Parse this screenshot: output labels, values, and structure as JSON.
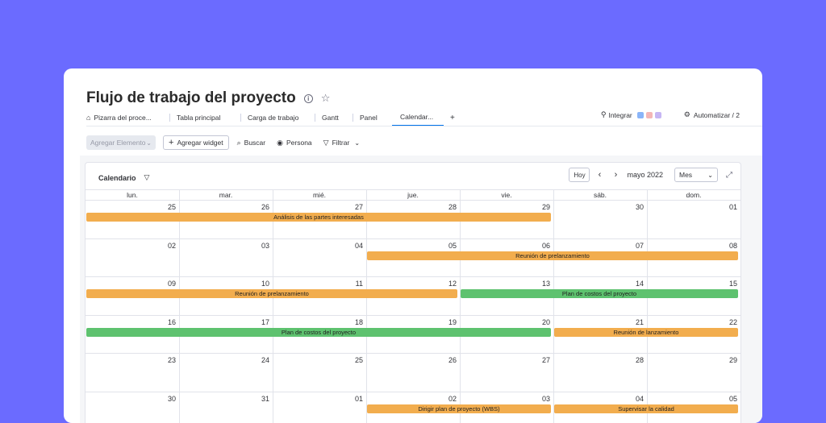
{
  "board": {
    "title": "Flujo de trabajo del proyecto",
    "info_icon": "info-icon",
    "star_icon": "star-icon"
  },
  "tabs": [
    {
      "label": "Pizarra del proce..."
    },
    {
      "label": "Tabla principal"
    },
    {
      "label": "Carga de trabajo"
    },
    {
      "label": "Gantt"
    },
    {
      "label": "Panel"
    },
    {
      "label": "Calendar..."
    },
    {
      "label": "+"
    }
  ],
  "tabs_right": {
    "integrar_label": "Integrar",
    "automatizar_label": "Automatizar / 2"
  },
  "toolbar": {
    "add_item_label": "Agregar Elemento",
    "add_widget_label": "Agregar widget",
    "search_label": "Buscar",
    "person_label": "Persona",
    "filter_label": "Filtrar"
  },
  "calendar": {
    "title": "Calendario",
    "today_label": "Hoy",
    "prev": "‹",
    "next": "›",
    "month_label": "mayo 2022",
    "view_label": "Mes",
    "weekdays": [
      "lun.",
      "mar.",
      "mié.",
      "jue.",
      "vie.",
      "sáb.",
      "dom."
    ],
    "weeks": [
      [
        "25",
        "26",
        "27",
        "28",
        "29",
        "30",
        "01"
      ],
      [
        "02",
        "03",
        "04",
        "05",
        "06",
        "07",
        "08"
      ],
      [
        "09",
        "10",
        "11",
        "12",
        "13",
        "14",
        "15"
      ],
      [
        "16",
        "17",
        "18",
        "19",
        "20",
        "21",
        "22"
      ],
      [
        "23",
        "24",
        "25",
        "26",
        "27",
        "28",
        "29"
      ],
      [
        "30",
        "31",
        "01",
        "02",
        "03",
        "04",
        "05"
      ]
    ],
    "events": [
      {
        "label": "Análisis de las partes interesadas",
        "week": 0,
        "start": 0,
        "end": 4,
        "color": "#f2ad4e"
      },
      {
        "label": "Reunión de prelanzamiento",
        "week": 1,
        "start": 3,
        "end": 6,
        "color": "#f2ad4e"
      },
      {
        "label": "Reunión de prelanzamiento",
        "week": 2,
        "start": 0,
        "end": 3,
        "color": "#f2ad4e"
      },
      {
        "label": "Plan de costos del proyecto",
        "week": 2,
        "start": 4,
        "end": 6,
        "color": "#5ec26f"
      },
      {
        "label": "Plan de costos del proyecto",
        "week": 3,
        "start": 0,
        "end": 4,
        "color": "#5ec26f"
      },
      {
        "label": "Reunión de lanzamiento",
        "week": 3,
        "start": 5,
        "end": 6,
        "color": "#f2ad4e"
      },
      {
        "label": "Dirigir plan de proyecto (WBS)",
        "week": 5,
        "start": 3,
        "end": 4,
        "color": "#f2ad4e"
      },
      {
        "label": "Supervisar la calidad",
        "week": 5,
        "start": 5,
        "end": 6,
        "color": "#f2ad4e"
      }
    ]
  },
  "colors": {
    "background": "#6b6bff",
    "accent": "#0073ea",
    "event_orange": "#f2ad4e",
    "event_green": "#5ec26f"
  }
}
